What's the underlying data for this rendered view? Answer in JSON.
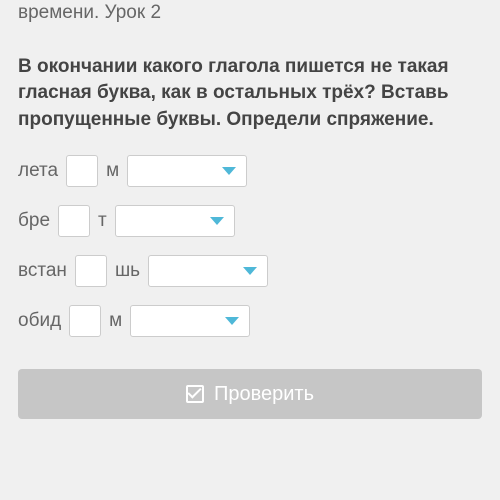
{
  "header": {
    "title_line": "времени. Урок 2"
  },
  "question": {
    "text": "В окончании какого глагола пишется не такая гласная буква, как в остальных трёх? Вставь пропущенные буквы. Определи спряжение."
  },
  "exercise": {
    "rows": [
      {
        "prefix": "лета",
        "input_value": "",
        "suffix": "м"
      },
      {
        "prefix": "бре",
        "input_value": "",
        "suffix": "т"
      },
      {
        "prefix": "встан",
        "input_value": "",
        "suffix": "шь"
      },
      {
        "prefix": "обид",
        "input_value": "",
        "suffix": "м"
      }
    ]
  },
  "actions": {
    "check_label": "Проверить"
  }
}
